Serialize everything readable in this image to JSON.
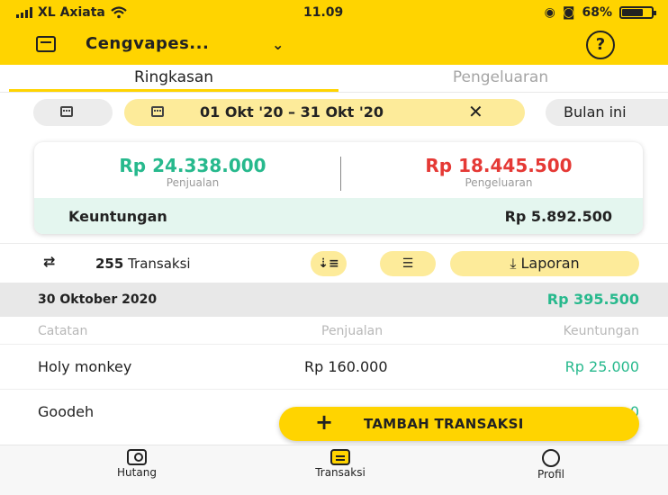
{
  "status_bar": {
    "carrier": "XL Axiata",
    "time": "11.09",
    "battery": "68%"
  },
  "header": {
    "store_name": "Cengvapes...",
    "help_label": "?"
  },
  "tabs": [
    {
      "label": "Ringkasan",
      "active": true
    },
    {
      "label": "Pengeluaran",
      "active": false
    }
  ],
  "date_filter": {
    "range": "01 Okt '20 – 31 Okt '20",
    "clear": "✕",
    "preset": "Bulan ini"
  },
  "summary": {
    "sales_value": "Rp 24.338.000",
    "sales_label": "Penjualan",
    "expense_value": "Rp 18.445.500",
    "expense_label": "Pengeluaran",
    "profit_label": "Keuntungan",
    "profit_value": "Rp 5.892.500"
  },
  "transactions_bar": {
    "count": "255",
    "count_label": "Transaksi",
    "report_label": "Laporan"
  },
  "day_group": {
    "date": "30 Oktober 2020",
    "total": "Rp 395.500"
  },
  "columns": {
    "note": "Catatan",
    "sales": "Penjualan",
    "profit": "Keuntungan"
  },
  "rows": [
    {
      "note": "Holy monkey",
      "sales": "Rp 160.000",
      "profit": "Rp 25.000"
    },
    {
      "note": "Goodeh",
      "sales": "",
      "profit": "0"
    }
  ],
  "fab": {
    "label": "TAMBAH TRANSAKSI"
  },
  "bottom_nav": [
    {
      "label": "Hutang",
      "icon": "debt-icon"
    },
    {
      "label": "Transaksi",
      "icon": "transaction-icon",
      "active": true
    },
    {
      "label": "Profil",
      "icon": "profile-icon"
    }
  ],
  "colors": {
    "accent": "#ffd400",
    "green": "#27b98d",
    "red": "#e53935",
    "profit_bg": "#e4f6ef"
  }
}
